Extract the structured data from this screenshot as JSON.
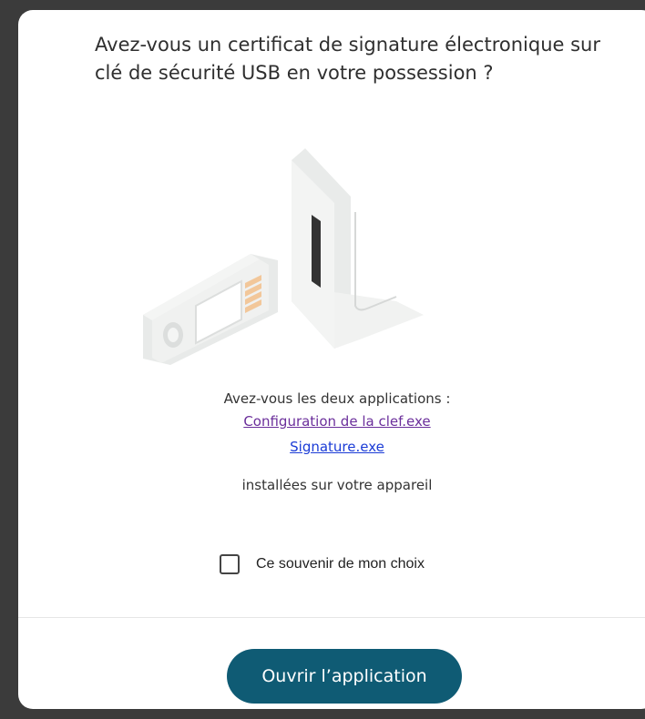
{
  "dialog": {
    "question": "Avez-vous un certificat de signature électronique sur clé de sécurité USB en votre possession ?",
    "apps_intro": "Avez-vous les deux applications :",
    "app_links": [
      "Configuration de la clef.exe",
      "Signature.exe"
    ],
    "installed_text": "installées sur votre appareil",
    "remember_label": "Ce souvenir de mon choix",
    "remember_checked": false,
    "open_button_label": "Ouvrir l’application"
  },
  "colors": {
    "accent": "#0f5b74",
    "visited_link": "#6b2f9b",
    "link": "#1a3bd6",
    "usb_contacts": "#f2c79a"
  },
  "illustration": {
    "icon": "usb-security-key-icon"
  }
}
